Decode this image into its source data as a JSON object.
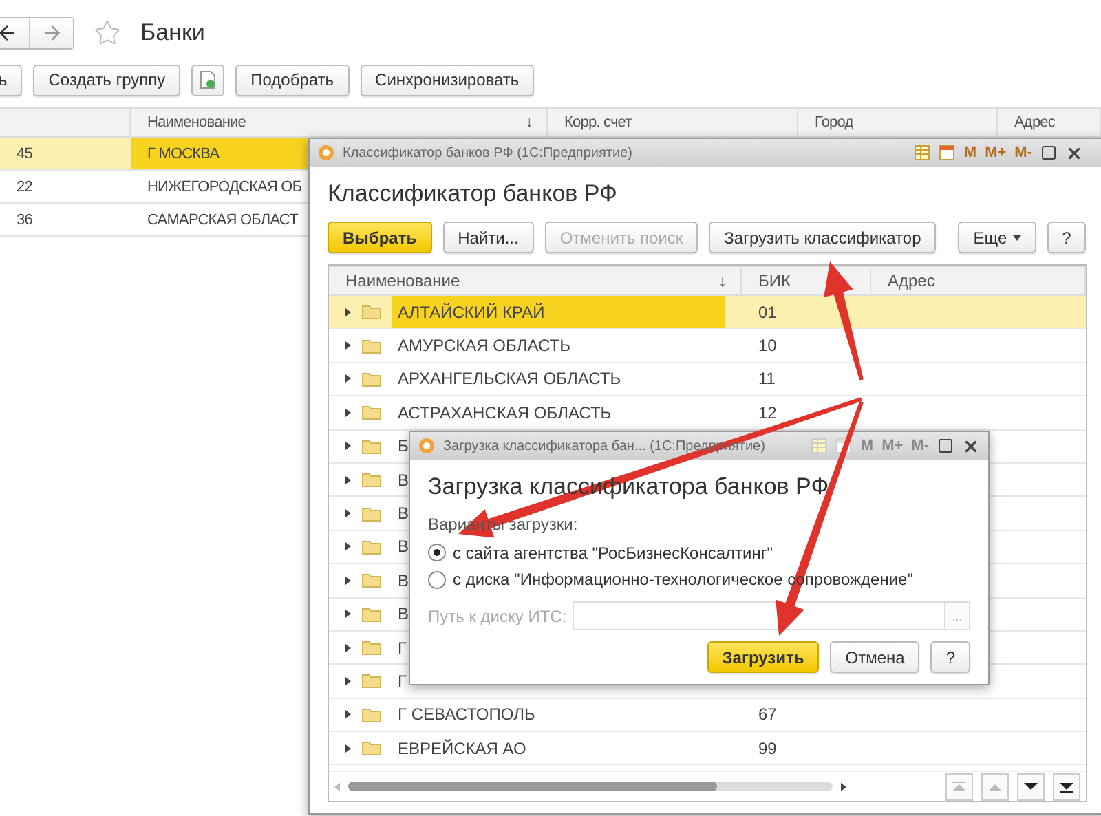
{
  "main": {
    "title": "Банки",
    "favorite": false,
    "toolbar": [
      {
        "kind": "button",
        "label": "ь"
      },
      {
        "kind": "button",
        "label": "Создать группу"
      },
      {
        "kind": "icon"
      },
      {
        "kind": "button",
        "label": "Подобрать"
      },
      {
        "kind": "button",
        "label": "Синхронизировать"
      }
    ],
    "columns": [
      {
        "label": "Наименование",
        "sort_mark": "↓"
      },
      {
        "label": "Корр. счет"
      },
      {
        "label": "Город"
      },
      {
        "label": "Адрес"
      }
    ],
    "rows": [
      {
        "code": "45",
        "name": "Г МОСКВА",
        "selected": true
      },
      {
        "code": "22",
        "name": "НИЖЕГОРОДСКАЯ ОБ",
        "selected": false
      },
      {
        "code": "36",
        "name": "САМАРСКАЯ ОБЛАСТ",
        "selected": false
      }
    ]
  },
  "classifier": {
    "window_title": "Классификатор банков РФ  (1С:Предприятие)",
    "heading": "Классификатор банков РФ",
    "memory_buttons": [
      {
        "label": "M",
        "disabled": false
      },
      {
        "label": "M+",
        "disabled": false
      },
      {
        "label": "M-",
        "disabled": false
      }
    ],
    "toolbar": [
      {
        "kind": "default",
        "label": "Выбрать",
        "disabled": false
      },
      {
        "kind": "normal",
        "label": "Найти...",
        "disabled": false
      },
      {
        "kind": "normal",
        "label": "Отменить поиск",
        "disabled": true
      },
      {
        "kind": "normal",
        "label": "Загрузить классификатор",
        "disabled": false
      }
    ],
    "more": "Еще",
    "help": "?",
    "columns": [
      {
        "label": "Наименование",
        "sort_mark": "↓"
      },
      {
        "label": "БИК"
      },
      {
        "label": "Адрес"
      }
    ],
    "rows": [
      {
        "name": "АЛТАЙСКИЙ КРАЙ",
        "code": "01",
        "selected": true
      },
      {
        "name": "АМУРСКАЯ ОБЛАСТЬ",
        "code": "10",
        "selected": false
      },
      {
        "name": "АРХАНГЕЛЬСКАЯ ОБЛАСТЬ",
        "code": "11",
        "selected": false
      },
      {
        "name": "АСТРАХАНСКАЯ ОБЛАСТЬ",
        "code": "12",
        "selected": false
      },
      {
        "name": "Б",
        "selected": false
      },
      {
        "name": "В",
        "selected": false
      },
      {
        "name": "В",
        "selected": false
      },
      {
        "name": "В",
        "selected": false
      },
      {
        "name": "В",
        "selected": false
      },
      {
        "name": "В",
        "selected": false
      },
      {
        "name": "Г",
        "selected": false
      },
      {
        "name": "Г",
        "selected": false
      },
      {
        "name": "Г СЕВАСТОПОЛЬ",
        "code": "67",
        "selected": false
      },
      {
        "name": "ЕВРЕЙСКАЯ АО",
        "code": "99",
        "selected": false
      }
    ]
  },
  "dialog": {
    "window_title": "Загрузка классификатора бан...  (1С:Предприятие)",
    "heading": "Загрузка классификатора банков РФ",
    "memory_buttons": [
      {
        "label": "M",
        "disabled": true
      },
      {
        "label": "M+",
        "disabled": true
      },
      {
        "label": "M-",
        "disabled": true
      }
    ],
    "options_label": "Варианты загрузки:",
    "options": [
      {
        "label": "с сайта агентства \"РосБизнесКонсалтинг\"",
        "selected": true
      },
      {
        "label": "с диска \"Информационно-технологическое сопровождение\"",
        "selected": false
      }
    ],
    "path": {
      "label": "Путь к диску ИТС:",
      "disabled": true,
      "button": "..."
    },
    "buttons": [
      {
        "kind": "default",
        "label": "Загрузить"
      },
      {
        "kind": "normal",
        "label": "Отмена"
      },
      {
        "kind": "normal",
        "label": "?"
      }
    ]
  }
}
